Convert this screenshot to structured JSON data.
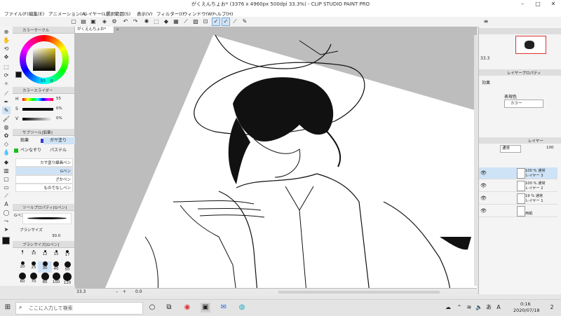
{
  "window": {
    "title": "がくえんちょお* (3376 x 4960px 500dpi 33.3%) - CLIP STUDIO PAINT PRO"
  },
  "menu": [
    "ファイル(F)",
    "編集(E)",
    "アニメーション(A)",
    "レイヤー(L)",
    "選択範囲(S)",
    "表示(V)",
    "フィルター(I)",
    "ウィンドウ(W)",
    "ヘルプ(H)"
  ],
  "color_panel": {
    "title": "カラーサークル",
    "value_left": "55",
    "value_right": "0"
  },
  "color_slider": {
    "title": "カラースライダー",
    "rows": [
      {
        "label": "H",
        "value": "55"
      },
      {
        "label": "S",
        "value": "0%"
      },
      {
        "label": "V",
        "value": "0%"
      }
    ]
  },
  "subtool": {
    "title": "サブツール[鉛筆]",
    "tabs": [
      "鉛筆",
      "ガサ塗り",
      "ペンなぞり",
      "パステル"
    ],
    "brushes": [
      "カサ塗り線画ペン",
      "Gペン",
      "ざかペン",
      "ものでなしペン"
    ]
  },
  "tool_property": {
    "title": "ツールプロパティ[Gペン]",
    "brush_name": "Gペン",
    "brush_size_label": "ブラシサイズ",
    "brush_size_value": "30.0"
  },
  "brush_size_panel": {
    "title": "ブラシサイズ[Gペン]",
    "sizes": [
      "7",
      "10",
      "12",
      "15",
      "17",
      "20",
      "25",
      "30",
      "40",
      "50",
      "60",
      "70",
      "80",
      "100",
      "120"
    ]
  },
  "document_tab": {
    "label": "がくえんちょお*"
  },
  "status": {
    "zoom": "33.3",
    "zoom_value": "0.0"
  },
  "navigator": {
    "zoom": "33.3"
  },
  "layer_property": {
    "title": "レイヤープロパティ",
    "effect_label": "効果",
    "display_color_label": "表現色",
    "display_color_value": "カラー"
  },
  "layers_panel": {
    "tab_label": "レイヤー",
    "blend_mode": "通常",
    "opacity": "100",
    "layers": [
      {
        "line1": "100 % 通常",
        "line2": "レイヤー 3"
      },
      {
        "line1": "100 % 通常",
        "line2": "レイヤー 2"
      },
      {
        "line1": "19 % 通常",
        "line2": "レイヤー 1"
      },
      {
        "line1": "",
        "line2": "用紙"
      }
    ]
  },
  "taskbar": {
    "search_placeholder": "ここに入力して検索",
    "time": "0:16",
    "date": "2020/07/18",
    "notification_count": "2",
    "ime": "A"
  }
}
